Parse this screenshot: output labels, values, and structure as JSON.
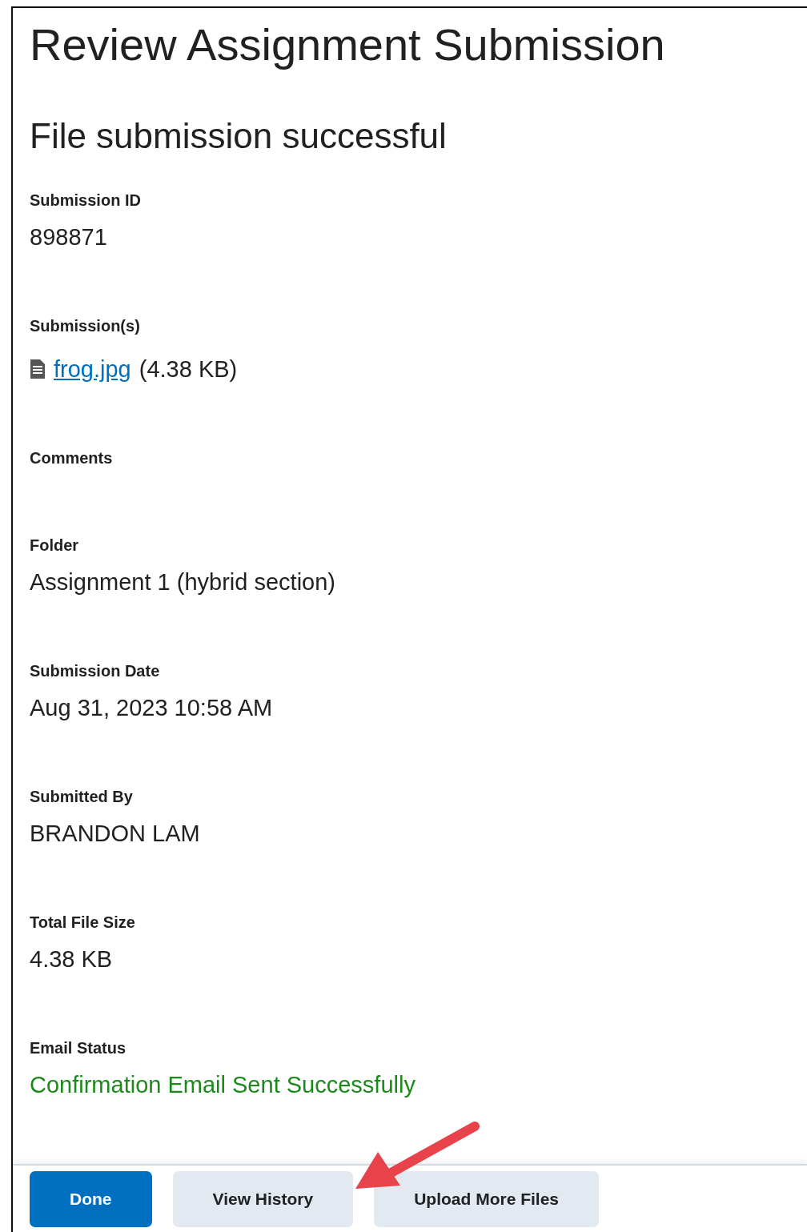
{
  "page_title": "Review Assignment Submission",
  "subtitle": "File submission successful",
  "fields": [
    {
      "kind": "text",
      "label": "Submission ID",
      "value": "898871"
    },
    {
      "kind": "file",
      "label": "Submission(s)",
      "file_name": "frog.jpg",
      "file_size": "(4.38 KB)"
    },
    {
      "kind": "empty",
      "label": "Comments"
    },
    {
      "kind": "text",
      "label": "Folder",
      "value": "Assignment 1 (hybrid section)"
    },
    {
      "kind": "text",
      "label": "Submission Date",
      "value": "Aug 31, 2023 10:58 AM"
    },
    {
      "kind": "text",
      "label": "Submitted By",
      "value": "BRANDON LAM"
    },
    {
      "kind": "text",
      "label": "Total File Size",
      "value": "4.38 KB"
    },
    {
      "kind": "status",
      "label": "Email Status",
      "value": "Confirmation Email Sent Successfully"
    }
  ],
  "buttons": [
    {
      "label": "Done",
      "kind": "primary"
    },
    {
      "label": "View History",
      "kind": "secondary"
    },
    {
      "label": "Upload More Files",
      "kind": "secondary"
    }
  ]
}
